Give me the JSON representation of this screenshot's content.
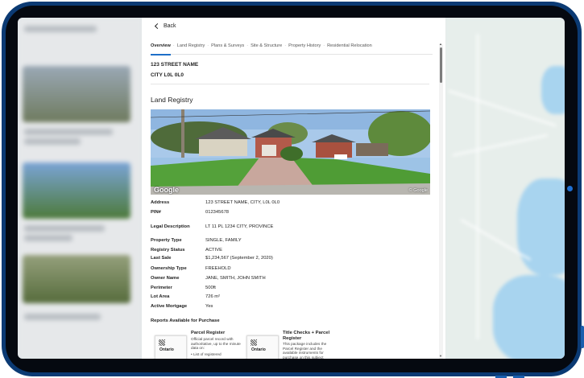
{
  "nav": {
    "back_label": "Back"
  },
  "tabs": [
    {
      "label": "Overview"
    },
    {
      "label": "Land Registry"
    },
    {
      "label": "Plans & Surveys"
    },
    {
      "label": "Site & Structure"
    },
    {
      "label": "Property History"
    },
    {
      "label": "Residential Relocation"
    }
  ],
  "header": {
    "street": "123 STREET NAME",
    "city": "CITY L0L 0L0"
  },
  "land_registry": {
    "title": "Land Registry",
    "photo": {
      "logo": "Google",
      "credit": "© Google"
    },
    "rows": [
      {
        "label": "Address",
        "value": "123 STREET NAME, CITY, L0L 0L0"
      },
      {
        "label": "PIN#",
        "value": "012345678"
      },
      {
        "label": "Legal Description",
        "value": "LT 11 PL 1234 CITY, PROVINCE"
      },
      {
        "label": "Property Type",
        "value": "SINGLE, FAMILY"
      },
      {
        "label": "Registry Status",
        "value": "ACTIVE"
      },
      {
        "label": "Last Sale",
        "value": "$1,234,567 (September 2, 2020)"
      },
      {
        "label": "Ownership Type",
        "value": "FREEHOLD"
      },
      {
        "label": "Owner Name",
        "value": "JANE, SMITH, JOHN SMITH"
      },
      {
        "label": "Perimeter",
        "value": "500ft"
      },
      {
        "label": "Lot Area",
        "value": "726 m²"
      },
      {
        "label": "Active Mortgage",
        "value": "Yes"
      }
    ]
  },
  "reports": {
    "title": "Reports Available for Purchase",
    "items": [
      {
        "title": "Parcel Register",
        "logo": "Ontario",
        "description": "Official parcel record with authoritative, up to the minute data on:",
        "bullet": "List of registered"
      },
      {
        "title": "Title Checks + Parcel Register",
        "logo": "Ontario",
        "description": "This package includes the Parcel Register and the available instruments for purchase on this subject"
      }
    ]
  },
  "colors": {
    "frame": "#0b3a73",
    "accent": "#1e6fc8"
  }
}
